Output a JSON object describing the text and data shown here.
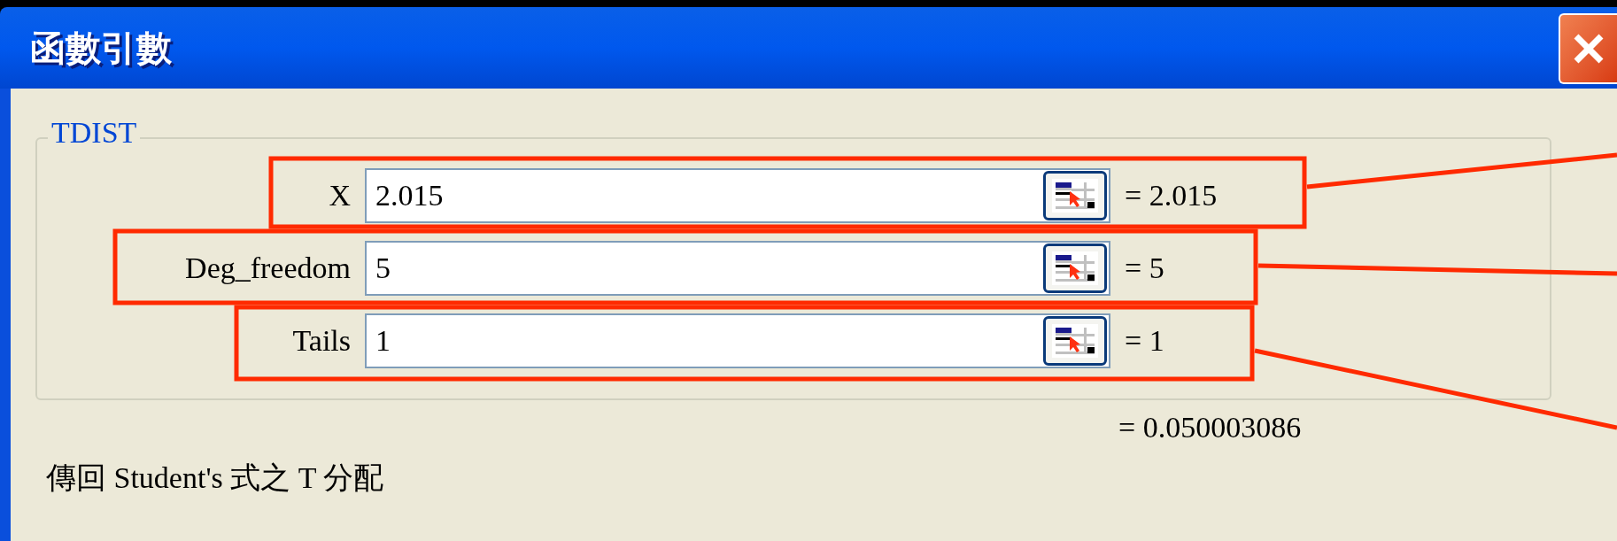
{
  "window": {
    "title": "函數引數"
  },
  "function_group": {
    "name": "TDIST",
    "arguments": [
      {
        "label": "X",
        "value": "2.015",
        "result": "= 2.015"
      },
      {
        "label": "Deg_freedom",
        "value": "5",
        "result": "= 5"
      },
      {
        "label": "Tails",
        "value": "1",
        "result": "= 1"
      }
    ]
  },
  "formula_result": "= 0.050003086",
  "description": "傳回 Student's 式之 T 分配"
}
